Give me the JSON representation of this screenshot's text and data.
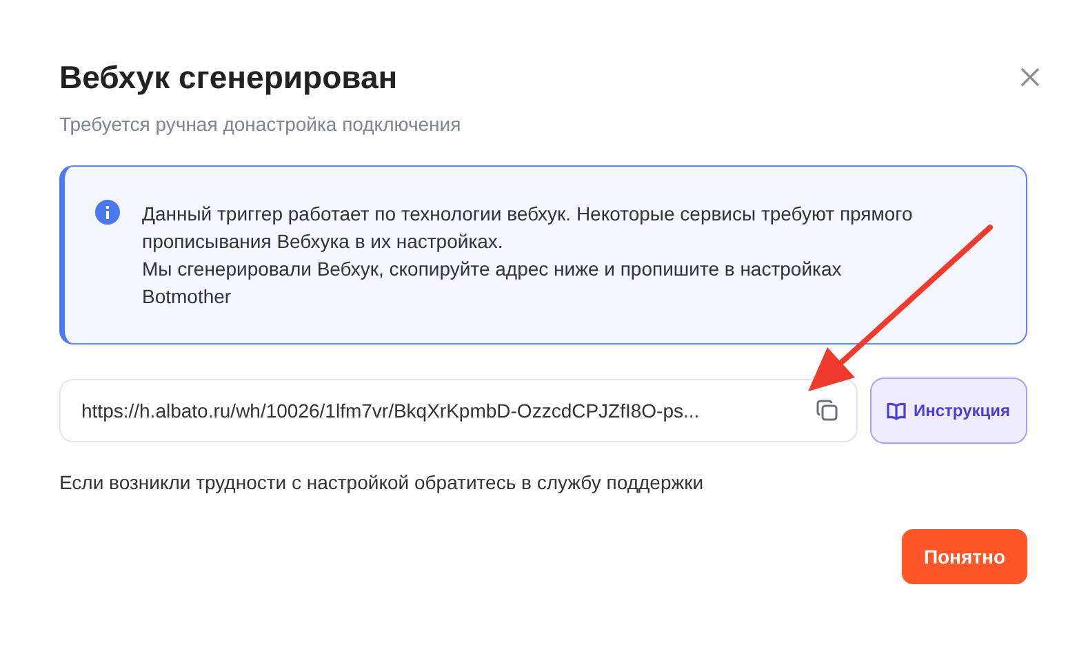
{
  "dialog": {
    "title": "Вебхук сгенерирован",
    "subtitle": "Требуется ручная донастройка подключения",
    "info": [
      "Данный триггер работает по технологии вебхук. Некоторые сервисы требуют прямого прописывания Вебхука в их настройках.",
      "Мы сгенерировали Вебхук, скопируйте адрес ниже и пропишите в настройках Botmother"
    ],
    "url_field": {
      "value": "https://h.albato.ru/wh/10026/1lfm7vr/BkqXrKpmbD-OzzcdCPJZfI8O-ps..."
    },
    "instruction_button": "Инструкция",
    "help_text": "Если возникли трудности с настройкой обратитесь в службу поддержки",
    "confirm_button": "Понятно"
  }
}
